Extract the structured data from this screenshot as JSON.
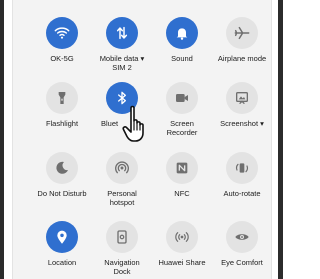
{
  "tiles": {
    "wifi": {
      "label": "OK-5G",
      "state": "on"
    },
    "mobile_data": {
      "label_line1": "Mobile data ▾",
      "label_line2": "SIM 2",
      "state": "on"
    },
    "sound": {
      "label": "Sound",
      "state": "on"
    },
    "airplane": {
      "label": "Airplane mode",
      "state": "off"
    },
    "flashlight": {
      "label": "Flashlight",
      "state": "off"
    },
    "bluetooth": {
      "label": "Bluet",
      "state": "on"
    },
    "screen_recorder": {
      "label_line1": "Screen",
      "label_line2": "Recorder",
      "state": "off"
    },
    "screenshot": {
      "label": "Screenshot ▾",
      "state": "off"
    },
    "do_not_disturb": {
      "label": "Do Not Disturb",
      "state": "off"
    },
    "personal_hotspot": {
      "label_line1": "Personal",
      "label_line2": "hotspot",
      "state": "off"
    },
    "nfc": {
      "label": "NFC",
      "state": "off"
    },
    "auto_rotate": {
      "label": "Auto-rotate",
      "state": "off"
    },
    "location": {
      "label": "Location",
      "state": "on"
    },
    "navigation_dock": {
      "label_line1": "Navigation",
      "label_line2": "Dock",
      "state": "off"
    },
    "huawei_share": {
      "label": "Huawei Share",
      "state": "off"
    },
    "eye_comfort": {
      "label": "Eye Comfort",
      "state": "off"
    }
  },
  "colors": {
    "active": "#2f6fcf",
    "inactive": "#e3e3e3",
    "inactive_icon": "#6f6f6f",
    "panel_bg": "#f3f3f3"
  },
  "icons": {
    "wifi": "wifi-icon",
    "mobile_data": "mobile-data-arrows-icon",
    "sound": "bell-icon",
    "airplane": "airplane-icon",
    "flashlight": "flashlight-icon",
    "bluetooth": "bluetooth-icon",
    "screen_recorder": "video-camera-icon",
    "screenshot": "screenshot-icon",
    "do_not_disturb": "moon-icon",
    "personal_hotspot": "hotspot-icon",
    "nfc": "nfc-icon",
    "auto_rotate": "auto-rotate-icon",
    "location": "location-pin-icon",
    "navigation_dock": "navigation-dock-icon",
    "huawei_share": "huawei-share-icon",
    "eye_comfort": "eye-icon",
    "cursor": "hand-pointer-icon"
  }
}
